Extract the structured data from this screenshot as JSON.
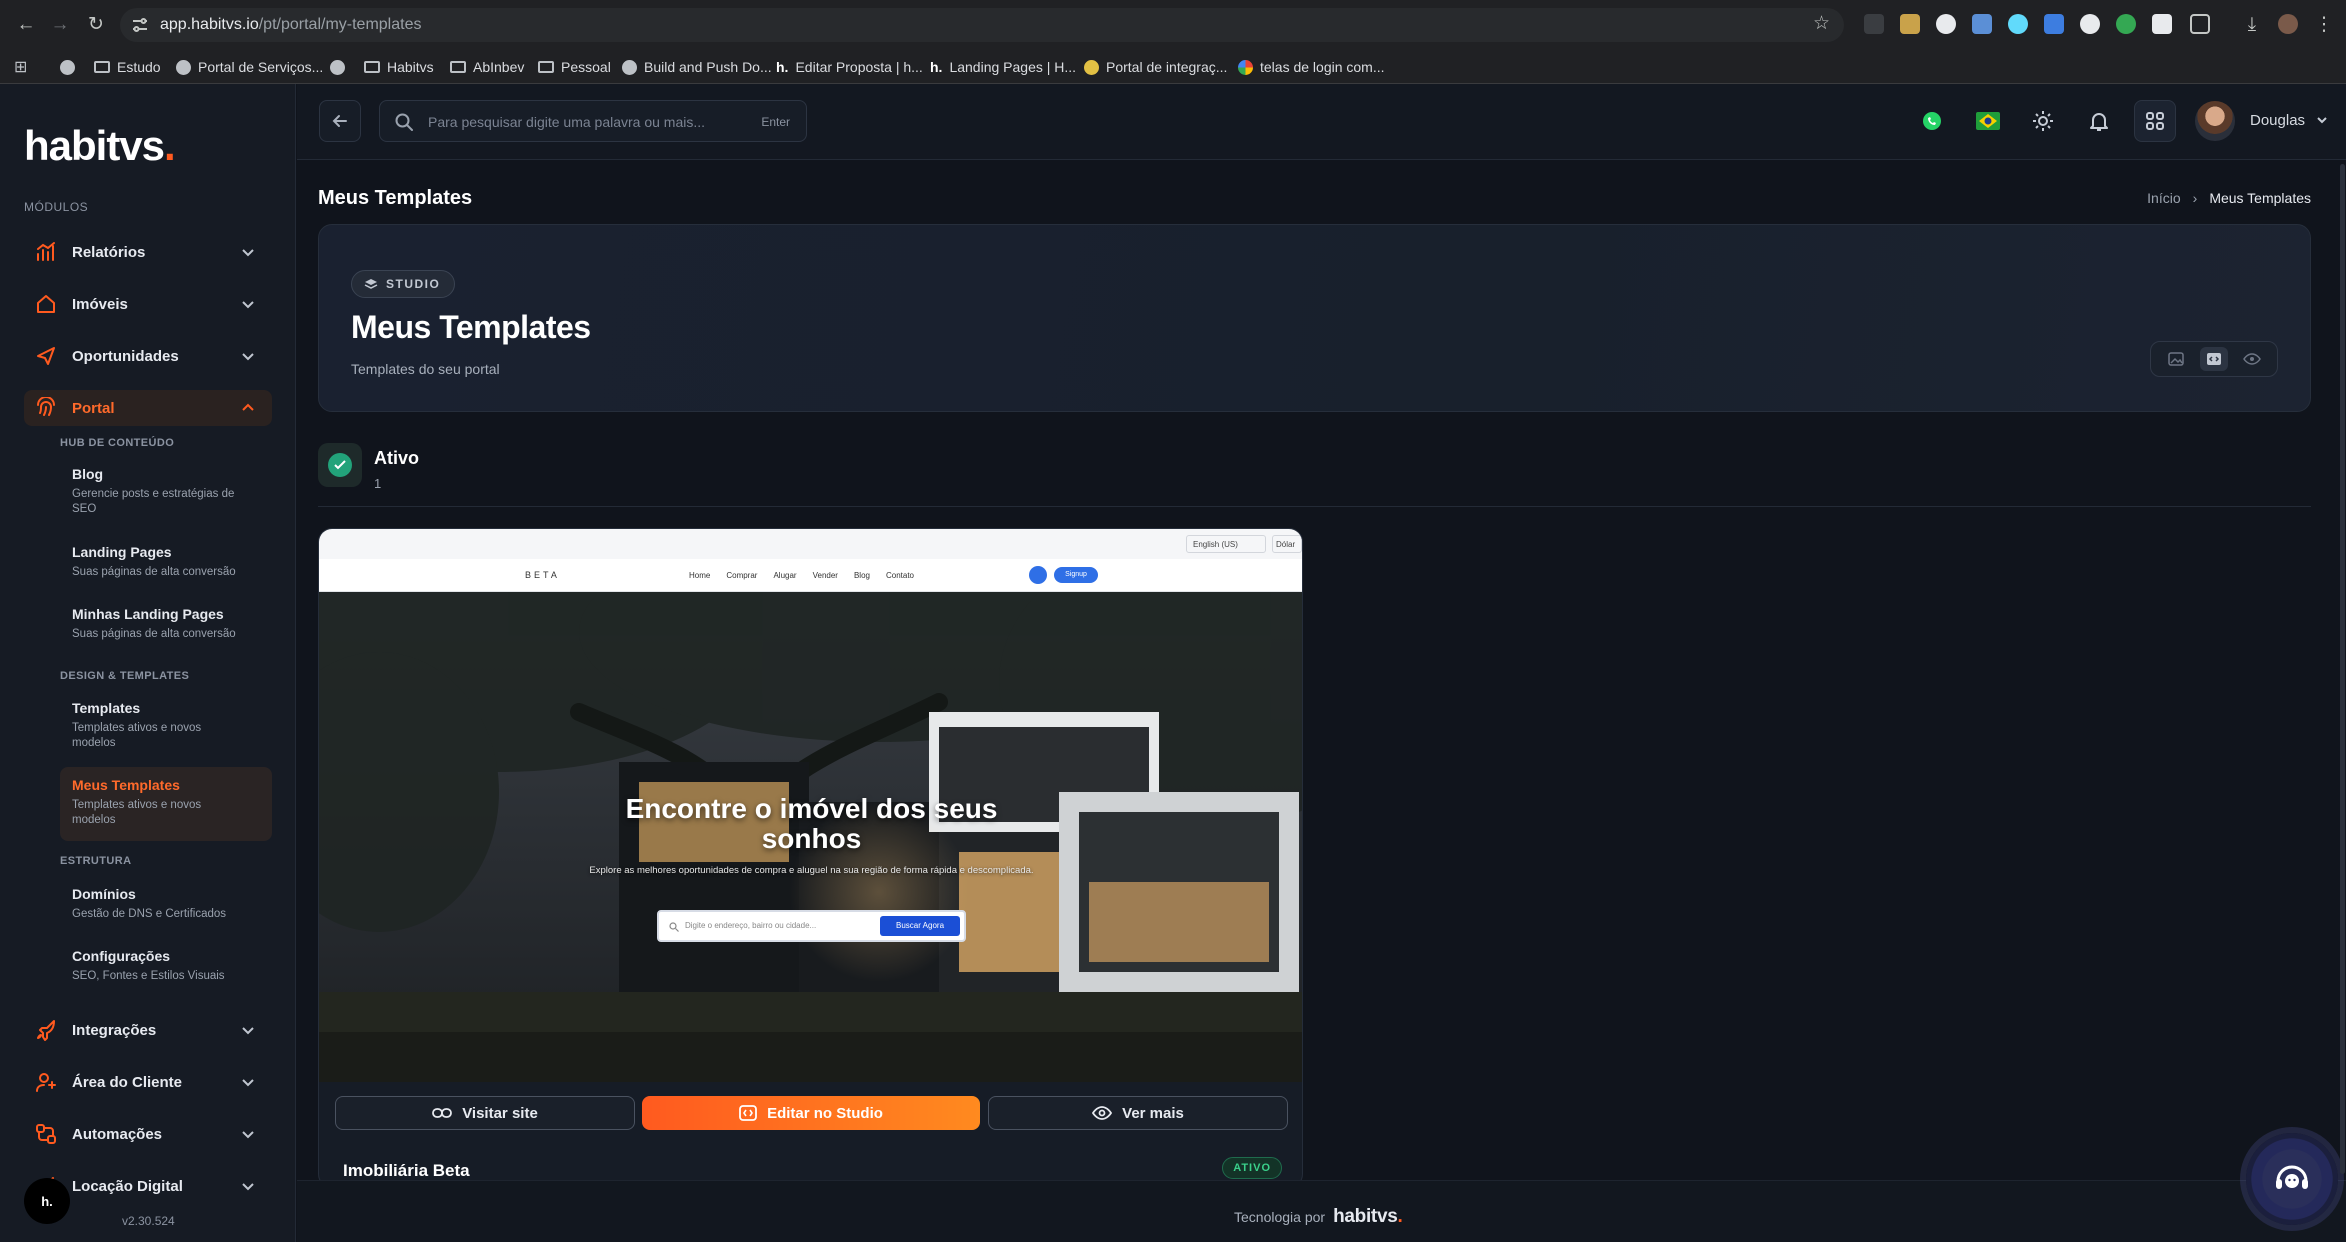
{
  "browser": {
    "url_host": "app.habitvs.io",
    "url_path": "/pt/portal/my-templates",
    "bookmarks": [
      {
        "label": "",
        "icon": "apps-icon"
      },
      {
        "label": "",
        "icon": "globe-icon"
      },
      {
        "label": "Estudo",
        "icon": "folder-icon"
      },
      {
        "label": "Portal de Serviços...",
        "icon": "globe-icon"
      },
      {
        "label": "",
        "icon": "globe-icon"
      },
      {
        "label": "Habitvs",
        "icon": "folder-icon"
      },
      {
        "label": "AbInbev",
        "icon": "folder-icon"
      },
      {
        "label": "Pessoal",
        "icon": "folder-icon"
      },
      {
        "label": "Build and Push Do...",
        "icon": "github-icon"
      },
      {
        "label": "Editar Proposta | h...",
        "icon": "habitvs-icon"
      },
      {
        "label": "Landing Pages | H...",
        "icon": "habitvs-icon"
      },
      {
        "label": "Portal de integraç...",
        "icon": "globe-icon"
      },
      {
        "label": "telas de login com...",
        "icon": "google-icon"
      }
    ]
  },
  "sidebar": {
    "logo": "habitvs",
    "logo_dot": ".",
    "modules_label": "MÓDULOS",
    "modules": [
      {
        "label": "Relatórios",
        "icon": "chart-icon"
      },
      {
        "label": "Imóveis",
        "icon": "house-icon"
      },
      {
        "label": "Oportunidades",
        "icon": "send-icon"
      },
      {
        "label": "Portal",
        "icon": "fingerprint-icon"
      },
      {
        "label": "Integrações",
        "icon": "rocket-icon"
      },
      {
        "label": "Área do Cliente",
        "icon": "user-icon"
      },
      {
        "label": "Automações",
        "icon": "automation-icon"
      },
      {
        "label": "Locação Digital",
        "icon": "key-icon"
      }
    ],
    "portal_groups": {
      "hub": "HUB DE CONTEÚDO",
      "design": "DESIGN & TEMPLATES",
      "estrutura": "ESTRUTURA"
    },
    "portal_items": [
      {
        "title": "Blog",
        "desc": "Gerencie posts e estratégias de SEO"
      },
      {
        "title": "Landing Pages",
        "desc": "Suas páginas de alta conversão"
      },
      {
        "title": "Minhas Landing Pages",
        "desc": "Suas páginas de alta conversão"
      },
      {
        "title": "Templates",
        "desc": "Templates ativos e novos modelos"
      },
      {
        "title": "Meus Templates",
        "desc": "Templates ativos e novos modelos"
      },
      {
        "title": "Domínios",
        "desc": "Gestão de DNS e Certificados"
      },
      {
        "title": "Configurações",
        "desc": "SEO, Fontes e Estilos Visuais"
      }
    ],
    "version": "v2.30.524",
    "badge": "h."
  },
  "topbar": {
    "search_placeholder": "Para pesquisar digite uma palavra ou mais...",
    "search_hint": "Enter",
    "user_name": "Douglas"
  },
  "page": {
    "title": "Meus Templates",
    "breadcrumb": {
      "home": "Início",
      "current": "Meus Templates"
    },
    "hero": {
      "pill": "STUDIO",
      "title": "Meus Templates",
      "subtitle": "Templates do seu portal"
    },
    "section": {
      "title": "Ativo",
      "count": "1"
    }
  },
  "template_card": {
    "name": "Imobiliária Beta",
    "status": "ATIVO",
    "actions": {
      "visit": "Visitar site",
      "edit": "Editar no Studio",
      "more": "Ver mais"
    },
    "preview": {
      "lang": "English (US)",
      "currency": "Dólar",
      "logo": "BETA",
      "menu": [
        "Home",
        "Comprar",
        "Alugar",
        "Vender",
        "Blog",
        "Contato"
      ],
      "signup": "Signup",
      "headline": "Encontre o imóvel dos seus sonhos",
      "paragraph": "Explore as melhores oportunidades de compra e aluguel na sua região de forma rápida e descomplicada.",
      "search_placeholder": "Digite o endereço, bairro ou cidade...",
      "search_button": "Buscar Agora"
    }
  },
  "footer": {
    "prefix": "Tecnologia por",
    "brand": "habitvs",
    "brand_dot": "."
  },
  "colors": {
    "accent": "#ff5a1f",
    "success": "#22a37a",
    "background": "#10141c"
  }
}
